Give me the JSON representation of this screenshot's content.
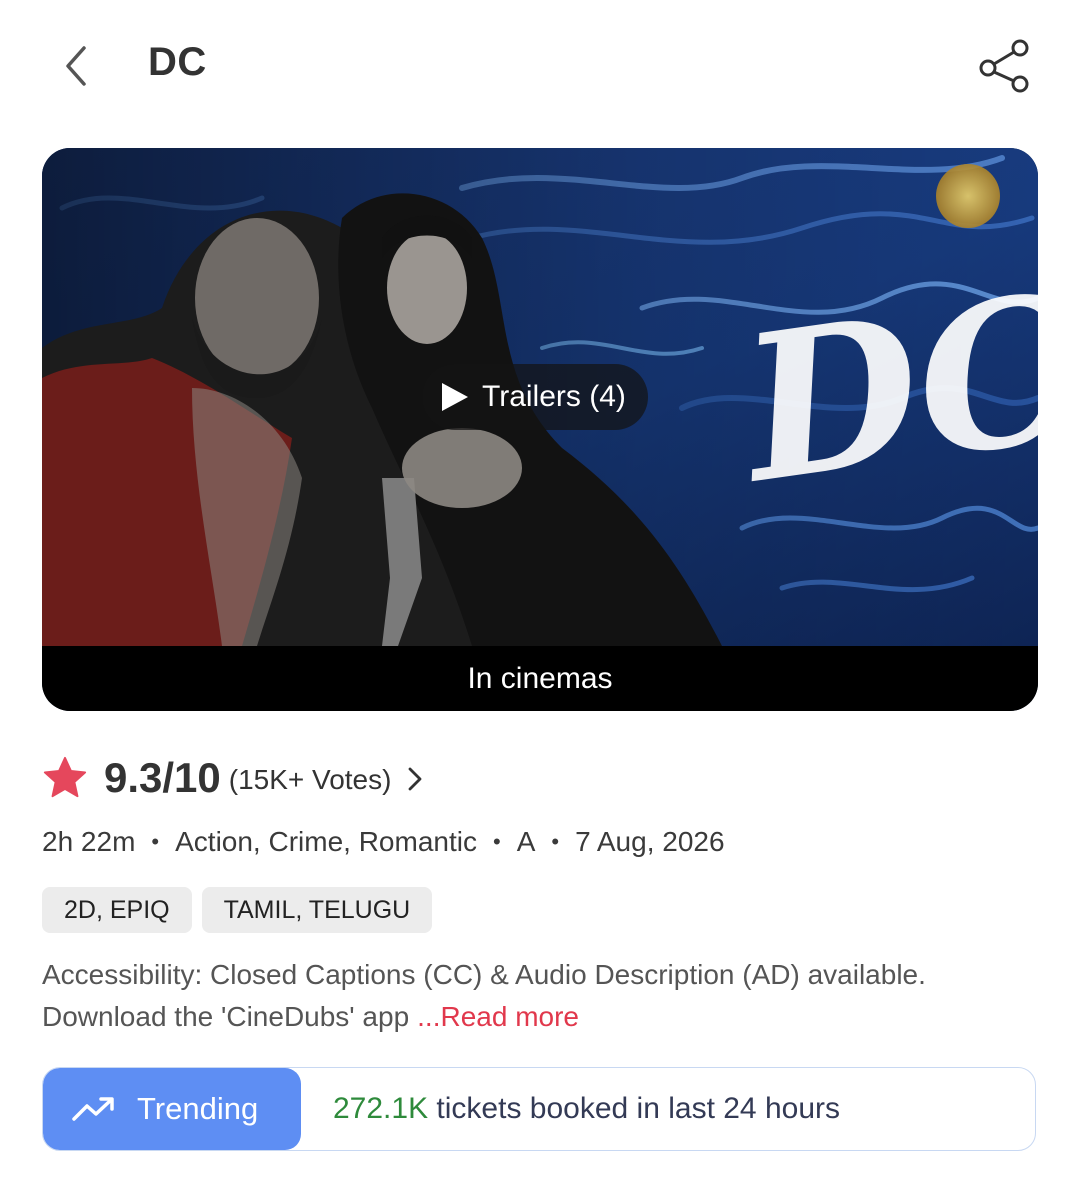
{
  "header": {
    "title": "DC",
    "back_icon": "chevron-left-icon",
    "share_icon": "share-icon"
  },
  "banner": {
    "trailer_label": "Trailers (4)",
    "status": "In cinemas",
    "logo_text": "DC"
  },
  "rating": {
    "score": "9.3/10",
    "votes": "(15K+ Votes)",
    "star_color": "#e5475c"
  },
  "meta": {
    "duration": "2h 22m",
    "genres": "Action, Crime, Romantic",
    "certificate": "A",
    "release_date": "7 Aug, 2026",
    "separator": "•"
  },
  "tags": [
    "2D, EPIQ",
    "TAMIL, TELUGU"
  ],
  "description": {
    "line1": "Accessibility: Closed Captions (CC) & Audio Description (AD) available.",
    "line2": "Download the 'CineDubs' app",
    "read_more": "...Read more"
  },
  "trending": {
    "label": "Trending",
    "count": "272.1K",
    "text": " tickets booked in last 24 hours",
    "accent": "#5e8ef3",
    "count_color": "#2e8a3b"
  }
}
